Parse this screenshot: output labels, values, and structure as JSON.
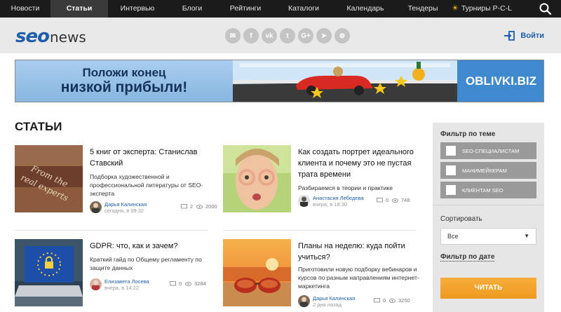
{
  "nav": {
    "items": [
      {
        "label": "Новости",
        "active": false
      },
      {
        "label": "Статьи",
        "active": true
      },
      {
        "label": "Интервью",
        "active": false
      },
      {
        "label": "Блоги",
        "active": false
      },
      {
        "label": "Рейтинги",
        "active": false
      },
      {
        "label": "Каталоги",
        "active": false
      },
      {
        "label": "Календарь",
        "active": false
      },
      {
        "label": "Тендеры",
        "active": false
      },
      {
        "label": "Турниры P-C-L",
        "active": false,
        "icon": "sun-icon"
      }
    ]
  },
  "header": {
    "logo_seo": "seo",
    "logo_news": "news",
    "socials": [
      "mail-icon",
      "facebook-icon",
      "vk-icon",
      "twitter-icon",
      "googleplus-icon",
      "telegram-icon",
      "rss-icon"
    ],
    "social_glyphs": [
      "✉",
      "f",
      "vk",
      "t",
      "G+",
      "➤",
      "⊚"
    ],
    "login_label": "Войти"
  },
  "banner": {
    "line1": "Положи конец",
    "line2": "низкой прибыли!",
    "brand": "OBLIVKI.BIZ"
  },
  "page_title": "СТАТЬИ",
  "articles": [
    {
      "title": "5 книг от эксперта: Станислав Ставский",
      "lead": "Подборка художественной и профессиональной литературы от SEO-эксперта",
      "author": "Дарья Калинская",
      "date": "сегодня, в 09:32",
      "comments": "2",
      "views": "2000"
    },
    {
      "title": "Как создать портрет идеального клиента и почему это не пустая трата времени",
      "lead": "Разбираемся в теории и практике",
      "author": "Анастасия Лебедева",
      "date": "вчера, в 18:30",
      "comments": "0",
      "views": "748"
    },
    {
      "title": "GDPR: что, как и зачем?",
      "lead": "Краткий гайд по Общему регламенту по защите данных",
      "author": "Елизавета Лосева",
      "date": "вчера, в 14:22",
      "comments": "0",
      "views": "3284"
    },
    {
      "title": "Планы на неделю: куда пойти учиться?",
      "lead": "Приготовили новую подборку вебинаров и курсов по разным направлениям интернет-маркетинга",
      "author": "Дарья Калинская",
      "date": "2 дня назад",
      "comments": "0",
      "views": "3250"
    }
  ],
  "sidebar": {
    "topic_heading": "Фильтр по теме",
    "topics": [
      "SEO-СПЕЦИАЛИСТАМ",
      "МАНИМЕЙКЕРАМ",
      "КЛИЕНТАМ SEO"
    ],
    "sort_heading": "Сортировать",
    "sort_value": "Все",
    "date_filter": "Фильтр по дате",
    "read_button": "ЧИТАТЬ"
  },
  "colors": {
    "nav_bg": "#1b1b1b",
    "brand_blue": "#1f5fa9",
    "button_orange": "#f2a22b"
  }
}
